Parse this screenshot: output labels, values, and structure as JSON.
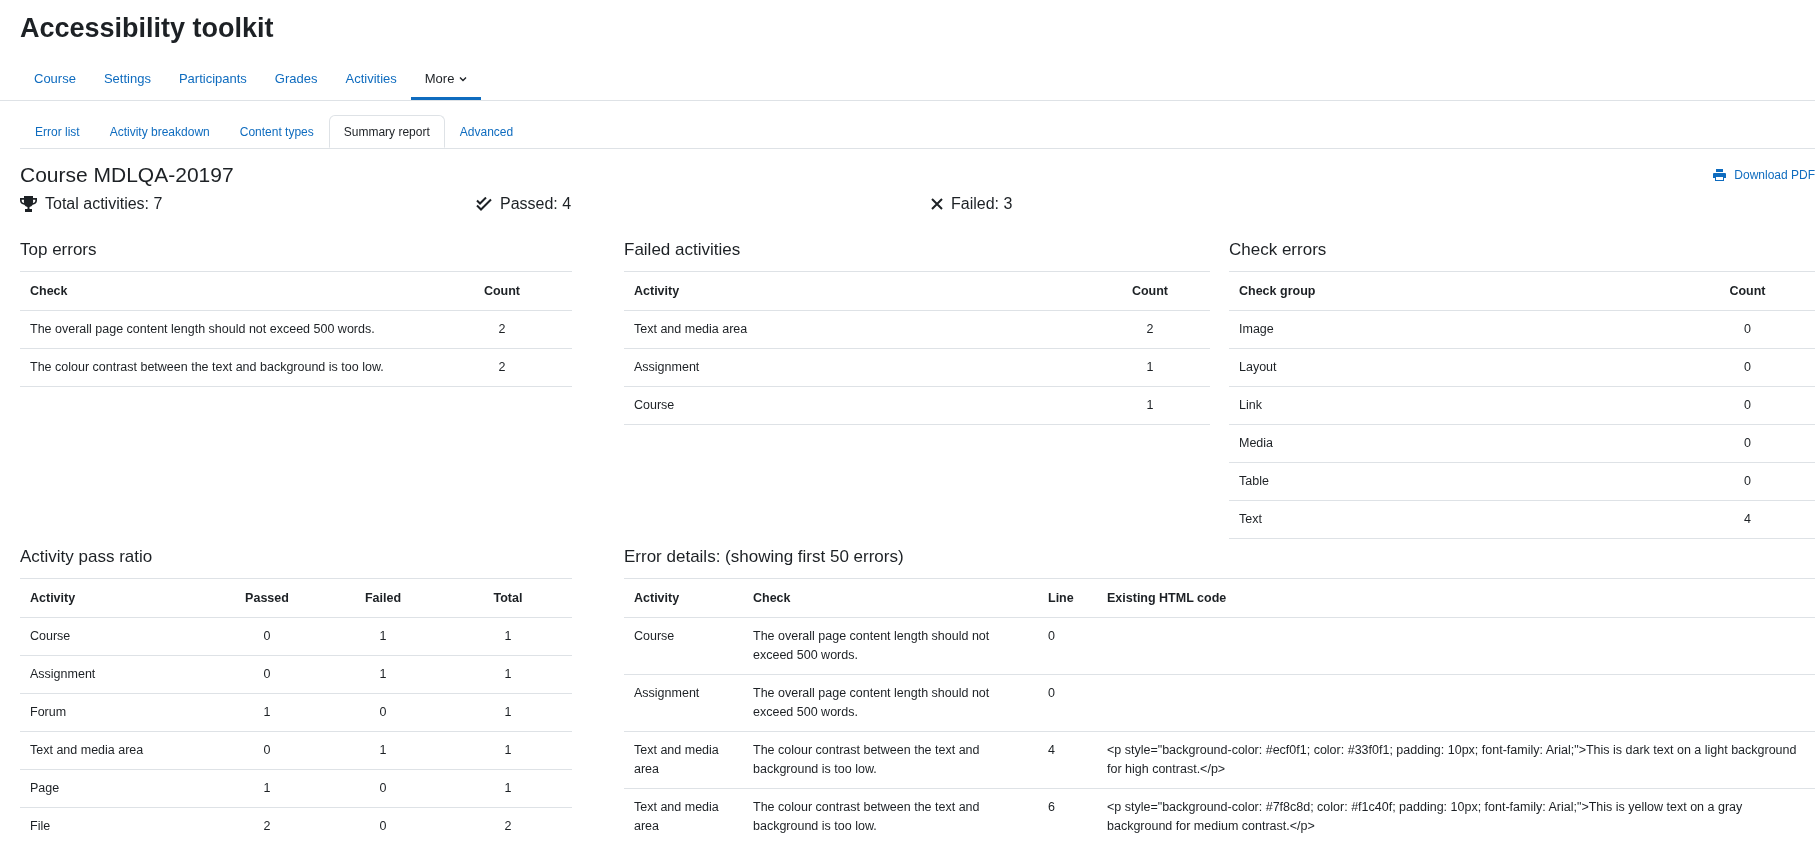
{
  "page_title": "Accessibility toolkit",
  "nav": [
    {
      "label": "Course",
      "selected": false
    },
    {
      "label": "Settings",
      "selected": false
    },
    {
      "label": "Participants",
      "selected": false
    },
    {
      "label": "Grades",
      "selected": false
    },
    {
      "label": "Activities",
      "selected": false
    },
    {
      "label": "More",
      "selected": true,
      "kind": "dropdown"
    }
  ],
  "subtabs": [
    {
      "label": "Error list",
      "selected": false
    },
    {
      "label": "Activity breakdown",
      "selected": false
    },
    {
      "label": "Content types",
      "selected": false
    },
    {
      "label": "Summary report",
      "selected": true
    },
    {
      "label": "Advanced",
      "selected": false
    }
  ],
  "course_heading": "Course MDLQA-20197",
  "download_link": "Download PDF",
  "summary": [
    {
      "kind": "total",
      "text": "Total activities: 7"
    },
    {
      "kind": "passed",
      "text": "Passed: 4"
    },
    {
      "kind": "failed",
      "text": "Failed: 3"
    }
  ],
  "top_errors": {
    "title": "Top errors",
    "columns": [
      "Check",
      "Count"
    ],
    "rows": [
      [
        "The overall page content length should not exceed 500 words.",
        "2"
      ],
      [
        "The colour contrast between the text and background is too low.",
        "2"
      ]
    ]
  },
  "failed_activities": {
    "title": "Failed activities",
    "columns": [
      "Activity",
      "Count"
    ],
    "rows": [
      [
        "Text and media area",
        "2"
      ],
      [
        "Assignment",
        "1"
      ],
      [
        "Course",
        "1"
      ]
    ]
  },
  "check_errors": {
    "title": "Check errors",
    "columns": [
      "Check group",
      "Count"
    ],
    "rows": [
      [
        "Image",
        "0"
      ],
      [
        "Layout",
        "0"
      ],
      [
        "Link",
        "0"
      ],
      [
        "Media",
        "0"
      ],
      [
        "Table",
        "0"
      ],
      [
        "Text",
        "4"
      ]
    ]
  },
  "activity_pass_ratio": {
    "title": "Activity pass ratio",
    "columns": [
      "Activity",
      "Passed",
      "Failed",
      "Total"
    ],
    "rows": [
      [
        "Course",
        "0",
        "1",
        "1"
      ],
      [
        "Assignment",
        "0",
        "1",
        "1"
      ],
      [
        "Forum",
        "1",
        "0",
        "1"
      ],
      [
        "Text and media area",
        "0",
        "1",
        "1"
      ],
      [
        "Page",
        "1",
        "0",
        "1"
      ],
      [
        "File",
        "2",
        "0",
        "2"
      ]
    ]
  },
  "error_details": {
    "title": "Error details: (showing first 50 errors)",
    "columns": [
      "Activity",
      "Check",
      "Line",
      "Existing HTML code"
    ],
    "rows": [
      [
        "Course",
        "The overall page content length should not exceed 500 words.",
        "0",
        ""
      ],
      [
        "Assignment",
        "The overall page content length should not exceed 500 words.",
        "0",
        ""
      ],
      [
        "Text and media area",
        "The colour contrast between the text and background is too low.",
        "4",
        "<p style=\"background-color: #ecf0f1; color: #33f0f1; padding: 10px; font-family: Arial;\">This is dark text on a light background for high contrast.</p>"
      ],
      [
        "Text and media area",
        "The colour contrast between the text and background is too low.",
        "6",
        "<p style=\"background-color: #7f8c8d; color: #f1c40f; padding: 10px; font-family: Arial;\">This is yellow text on a gray background for medium contrast.</p>"
      ]
    ]
  }
}
